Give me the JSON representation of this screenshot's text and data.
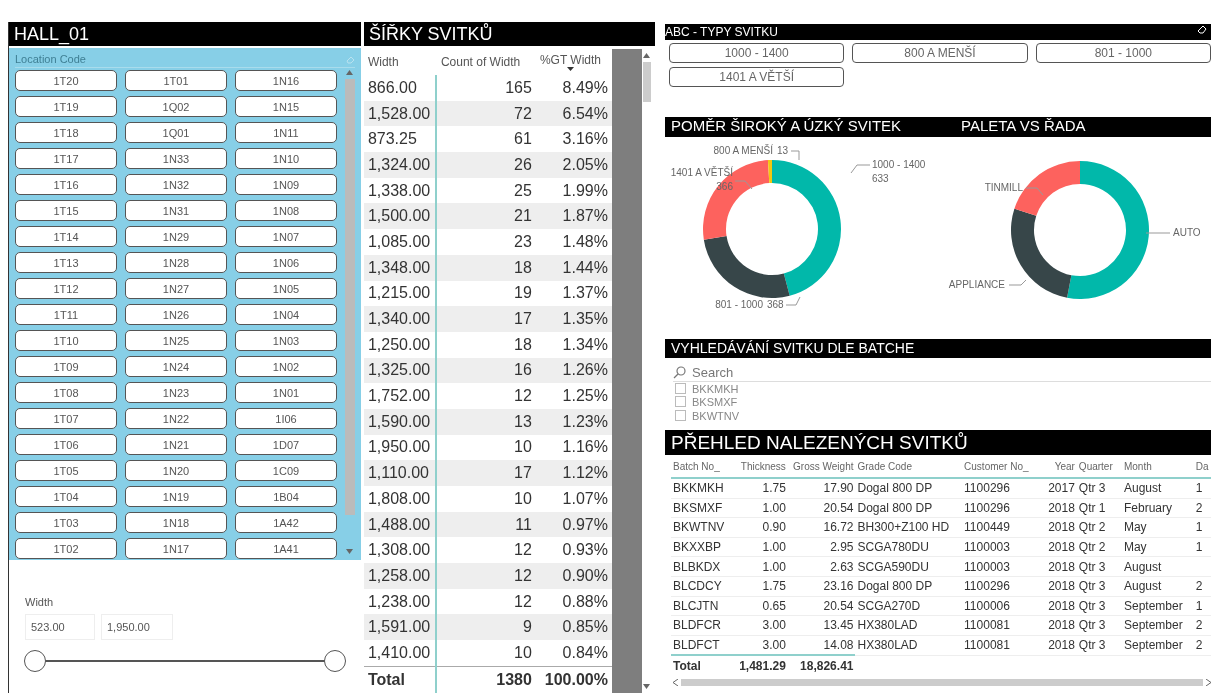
{
  "hall": {
    "title": "HALL_01",
    "slicer_header": "Location Code",
    "items": [
      {
        "label": "1T20",
        "selected": false
      },
      {
        "label": "1T01",
        "selected": false
      },
      {
        "label": "1N16",
        "selected": false
      },
      {
        "label": "1T19",
        "selected": false
      },
      {
        "label": "1Q02",
        "selected": false
      },
      {
        "label": "1N15",
        "selected": false
      },
      {
        "label": "1T18",
        "selected": false
      },
      {
        "label": "1Q01",
        "selected": false
      },
      {
        "label": "1N11",
        "selected": false
      },
      {
        "label": "1T17",
        "selected": false
      },
      {
        "label": "1N33",
        "selected": false
      },
      {
        "label": "1N10",
        "selected": false
      },
      {
        "label": "1T16",
        "selected": false
      },
      {
        "label": "1N32",
        "selected": false
      },
      {
        "label": "1N09",
        "selected": false
      },
      {
        "label": "1T15",
        "selected": false
      },
      {
        "label": "1N31",
        "selected": false
      },
      {
        "label": "1N08",
        "selected": false
      },
      {
        "label": "1T14",
        "selected": false
      },
      {
        "label": "1N29",
        "selected": false
      },
      {
        "label": "1N07",
        "selected": false
      },
      {
        "label": "1T13",
        "selected": false
      },
      {
        "label": "1N28",
        "selected": false
      },
      {
        "label": "1N06",
        "selected": false
      },
      {
        "label": "1T12",
        "selected": false
      },
      {
        "label": "1N27",
        "selected": false
      },
      {
        "label": "1N05",
        "selected": false
      },
      {
        "label": "1T11",
        "selected": false
      },
      {
        "label": "1N26",
        "selected": false
      },
      {
        "label": "1N04",
        "selected": false
      },
      {
        "label": "1T10",
        "selected": false
      },
      {
        "label": "1N25",
        "selected": false
      },
      {
        "label": "1N03",
        "selected": false
      },
      {
        "label": "1T09",
        "selected": false
      },
      {
        "label": "1N24",
        "selected": false
      },
      {
        "label": "1N02",
        "selected": false
      },
      {
        "label": "1T08",
        "selected": false
      },
      {
        "label": "1N23",
        "selected": false
      },
      {
        "label": "1N01",
        "selected": false
      },
      {
        "label": "1T07",
        "selected": false
      },
      {
        "label": "1N22",
        "selected": false
      },
      {
        "label": "1I06",
        "selected": false
      },
      {
        "label": "1T06",
        "selected": false
      },
      {
        "label": "1N21",
        "selected": false
      },
      {
        "label": "1D07",
        "selected": false
      },
      {
        "label": "1T05",
        "selected": false
      },
      {
        "label": "1N20",
        "selected": false
      },
      {
        "label": "1C09",
        "selected": false
      },
      {
        "label": "1T04",
        "selected": false
      },
      {
        "label": "1N19",
        "selected": false
      },
      {
        "label": "1B04",
        "selected": false
      },
      {
        "label": "1T03",
        "selected": false
      },
      {
        "label": "1N18",
        "selected": false
      },
      {
        "label": "1A42",
        "selected": false
      },
      {
        "label": "1T02",
        "selected": false
      },
      {
        "label": "1N17",
        "selected": false
      },
      {
        "label": "1A41",
        "selected": false
      }
    ],
    "width_filter": {
      "label": "Width",
      "min": "523.00",
      "max": "1,950.00",
      "thumbs": [
        {
          "level": 0
        },
        {
          "level": 1
        }
      ]
    }
  },
  "widths_table": {
    "title": "ŠÍŘKY SVITKŮ",
    "columns": [
      {
        "label": "Width",
        "sorted": false
      },
      {
        "label": "Count of Width",
        "sorted": false
      },
      {
        "label": "%GT Width",
        "sorted": true
      }
    ],
    "rows": [
      [
        "866.00",
        "165",
        "8.49%"
      ],
      [
        "1,528.00",
        "72",
        "6.54%"
      ],
      [
        "873.25",
        "61",
        "3.16%"
      ],
      [
        "1,324.00",
        "26",
        "2.05%"
      ],
      [
        "1,338.00",
        "25",
        "1.99%"
      ],
      [
        "1,500.00",
        "21",
        "1.87%"
      ],
      [
        "1,085.00",
        "23",
        "1.48%"
      ],
      [
        "1,348.00",
        "18",
        "1.44%"
      ],
      [
        "1,215.00",
        "19",
        "1.37%"
      ],
      [
        "1,340.00",
        "17",
        "1.35%"
      ],
      [
        "1,250.00",
        "18",
        "1.34%"
      ],
      [
        "1,325.00",
        "16",
        "1.26%"
      ],
      [
        "1,752.00",
        "12",
        "1.25%"
      ],
      [
        "1,590.00",
        "13",
        "1.23%"
      ],
      [
        "1,950.00",
        "10",
        "1.16%"
      ],
      [
        "1,110.00",
        "17",
        "1.12%"
      ],
      [
        "1,808.00",
        "10",
        "1.07%"
      ],
      [
        "1,488.00",
        "11",
        "0.97%"
      ],
      [
        "1,308.00",
        "12",
        "0.93%"
      ],
      [
        "1,258.00",
        "12",
        "0.90%"
      ],
      [
        "1,238.00",
        "12",
        "0.88%"
      ],
      [
        "1,591.00",
        "9",
        "0.85%"
      ],
      [
        "1,410.00",
        "10",
        "0.84%"
      ]
    ],
    "total": [
      "Total",
      "1380",
      "100.00%"
    ]
  },
  "types": {
    "title": "ABC - TYPY SVITKU",
    "buttons": [
      {
        "label": "1000 - 1400",
        "selected": false
      },
      {
        "label": "800 A MENŠÍ",
        "selected": false
      },
      {
        "label": "801 - 1000",
        "selected": false
      },
      {
        "label": "1401 A VĚTŠÍ",
        "selected": false
      }
    ]
  },
  "ratio_chart": {
    "title": "POMĚR ŠIROKÝ A ÚZKÝ SVITEK",
    "chart_data": {
      "type": "donut",
      "categories": [
        "1000 - 1400",
        "801 - 1000",
        "1401 A VĚTŠÍ",
        "800 A MENŠÍ"
      ],
      "values": [
        633,
        368,
        366,
        13
      ],
      "colors": [
        "#01b8aa",
        "#374649",
        "#fd625e",
        "#f2c80f"
      ],
      "data_labels": true
    }
  },
  "pallet_chart": {
    "title": "PALETA VS ŘADA",
    "labels": [
      {
        "label": "AUTO",
        "color": "#01b8aa"
      },
      {
        "label": "APPLIANCE",
        "color": "#374649"
      },
      {
        "label": "TINMILL",
        "color": "#fd625e"
      }
    ]
  },
  "batch_search": {
    "title": "VYHLEDÁVÁNÍ SVITKU DLE BATCHE",
    "placeholder": "Search",
    "items": [
      {
        "label": "BKKMKH",
        "checked": false
      },
      {
        "label": "BKSMXF",
        "checked": false
      },
      {
        "label": "BKWTNV",
        "checked": false
      }
    ]
  },
  "found_table": {
    "title": "PŘEHLED NALEZENÝCH SVITKŮ",
    "columns": [
      "Batch No_",
      "Thickness",
      "Gross Weight",
      "Grade Code",
      "Customer No_",
      "Year",
      "Quarter",
      "Month",
      "Da"
    ],
    "rows": [
      [
        "BKKMKH",
        "1.75",
        "17.90",
        "Dogal 800 DP",
        "1100296",
        "2017",
        "Qtr 3",
        "August",
        "1"
      ],
      [
        "BKSMXF",
        "1.00",
        "20.54",
        "Dogal 800 DP",
        "1100296",
        "2018",
        "Qtr 1",
        "February",
        "2"
      ],
      [
        "BKWTNV",
        "0.90",
        "16.72",
        "BH300+Z100 HD",
        "1100449",
        "2018",
        "Qtr 2",
        "May",
        "1"
      ],
      [
        "BKXXBP",
        "1.00",
        "2.95",
        "SCGA780DU",
        "1100003",
        "2018",
        "Qtr 2",
        "May",
        "1"
      ],
      [
        "BLBKDX",
        "1.00",
        "2.63",
        "SCGA590DU",
        "1100003",
        "2018",
        "Qtr 3",
        "August",
        null
      ],
      [
        "BLCDCY",
        "1.75",
        "23.16",
        "Dogal 800 DP",
        "1100296",
        "2018",
        "Qtr 3",
        "August",
        "2"
      ],
      [
        "BLCJTN",
        "0.65",
        "20.54",
        "SCGA270D",
        "1100006",
        "2018",
        "Qtr 3",
        "September",
        "1"
      ],
      [
        "BLDFCR",
        "3.00",
        "13.45",
        "HX380LAD",
        "1100081",
        "2018",
        "Qtr 3",
        "September",
        "2"
      ],
      [
        "BLDFCT",
        "3.00",
        "14.08",
        "HX380LAD",
        "1100081",
        "2018",
        "Qtr 3",
        "September",
        "2"
      ]
    ],
    "total": [
      "Total",
      "1,481.29",
      "18,826.41"
    ]
  }
}
